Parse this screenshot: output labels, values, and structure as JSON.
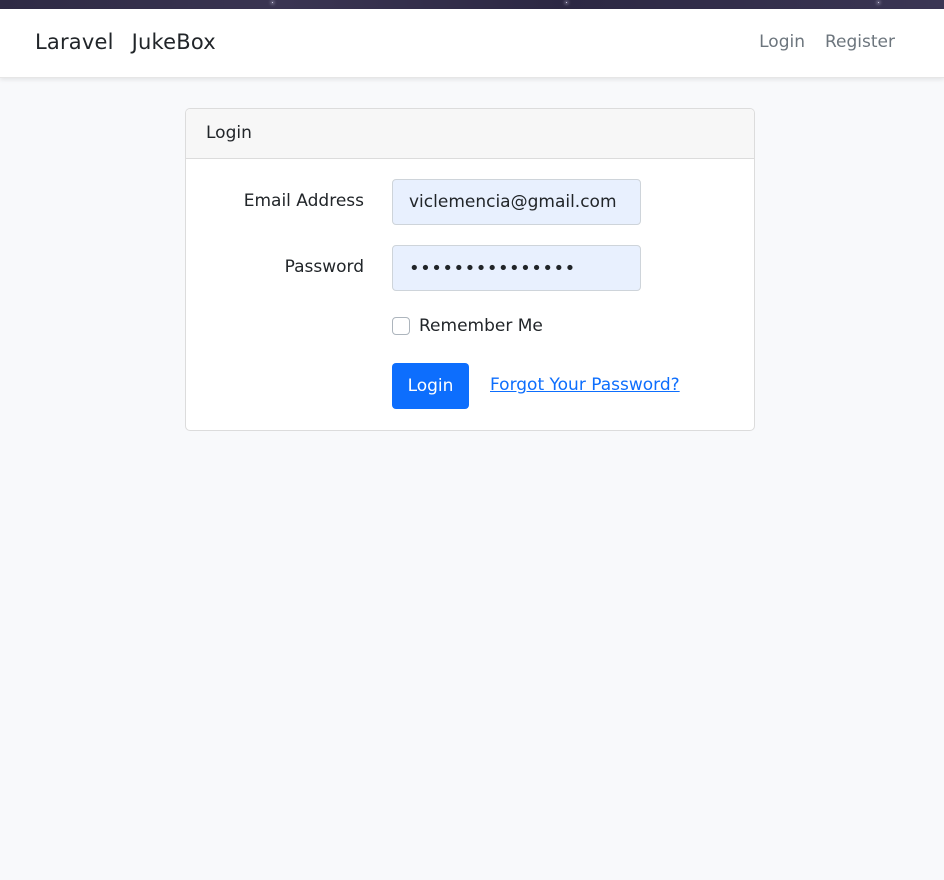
{
  "navbar": {
    "brand_part1": "Laravel",
    "brand_part2": "JukeBox",
    "links": [
      {
        "label": "Login"
      },
      {
        "label": "Register"
      }
    ]
  },
  "login_card": {
    "header": "Login",
    "email_label": "Email Address",
    "email_value": "viclemencia@gmail.com",
    "password_label": "Password",
    "password_value": "•••••••••••••••",
    "remember_label": "Remember Me",
    "remember_checked": false,
    "submit_label": "Login",
    "forgot_label": "Forgot Your Password?"
  },
  "colors": {
    "primary": "#0d6efd",
    "autofill_bg": "#e8f0fe",
    "page_bg": "#f8f9fb"
  }
}
